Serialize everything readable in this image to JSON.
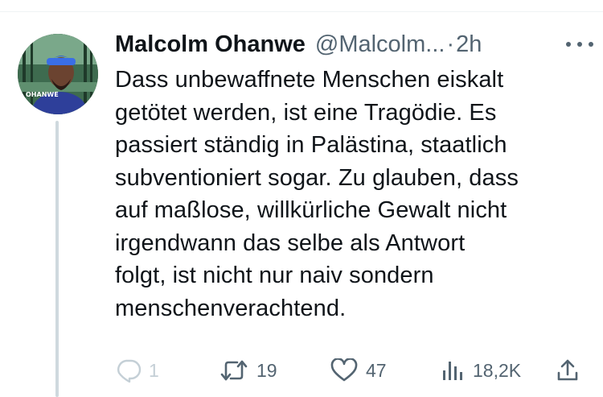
{
  "tweet": {
    "author_name": "Malcolm Ohanwe",
    "author_handle": "@Malcolm...",
    "separator": "·",
    "timestamp": "2h",
    "avatar_caption": "OHANWE",
    "text_lines": [
      "Dass unbewaffnete Menschen eiskalt",
      "getötet werden, ist eine Tragödie. Es",
      "passiert ständig in Palästina, staatlich",
      "subventioniert sogar. Zu glauben, dass",
      "auf maßlose, willkürliche Gewalt nicht",
      "irgendwann das selbe als Antwort",
      "folgt, ist nicht nur naiv sondern",
      "menschenverachtend."
    ]
  },
  "actions": {
    "reply": {
      "icon": "reply-icon",
      "count": "1"
    },
    "retweet": {
      "icon": "retweet-icon",
      "count": "19"
    },
    "like": {
      "icon": "heart-icon",
      "count": "47"
    },
    "views": {
      "icon": "views-icon",
      "count": "18,2K"
    },
    "share": {
      "icon": "share-icon"
    }
  },
  "colors": {
    "text_primary": "#0f1419",
    "text_secondary": "#536471",
    "thread_line": "#cfd9de",
    "reply_faded": "#c4cfd6"
  }
}
